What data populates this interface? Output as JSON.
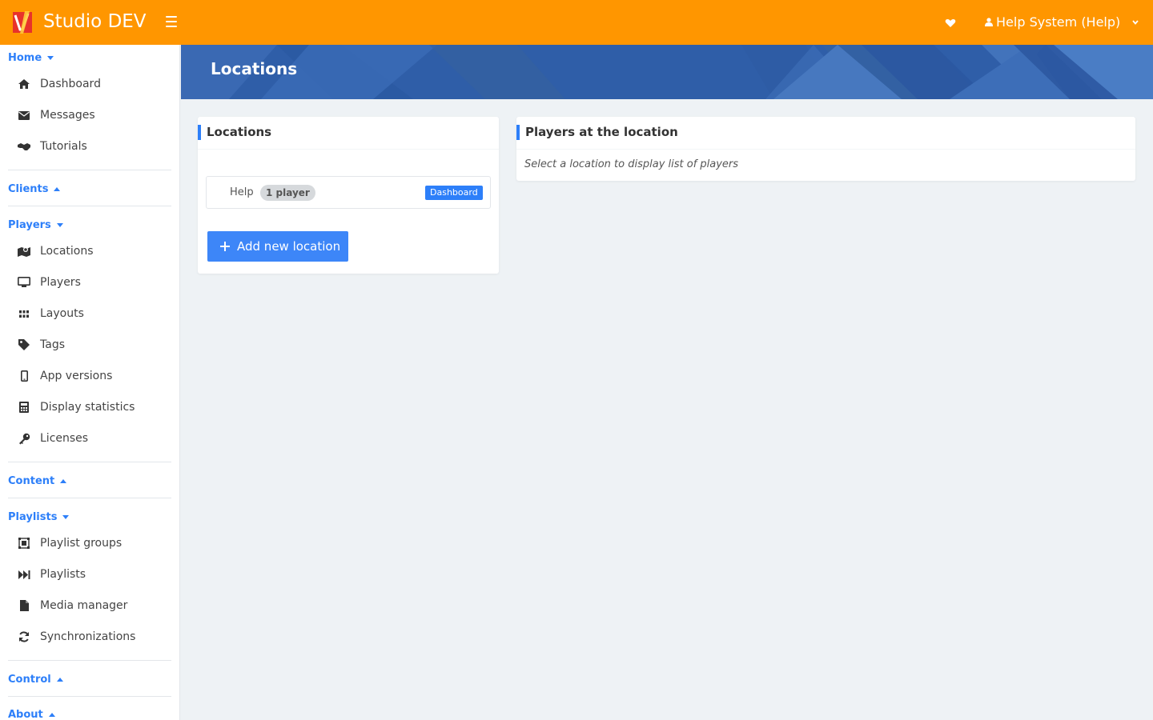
{
  "app": {
    "brand": "Studio DEV",
    "user_label": "Help System (Help)",
    "accent_color": "#ff9600",
    "link_color": "#2d7ff9"
  },
  "sidebar": {
    "sections": {
      "home": "Home",
      "clients": "Clients",
      "players": "Players",
      "content": "Content",
      "playlists": "Playlists",
      "control": "Control",
      "about": "About"
    },
    "items": {
      "dashboard": "Dashboard",
      "messages": "Messages",
      "tutorials": "Tutorials",
      "locations": "Locations",
      "players": "Players",
      "layouts": "Layouts",
      "tags": "Tags",
      "app_versions": "App versions",
      "display_statistics": "Display statistics",
      "licenses": "Licenses",
      "playlist_groups": "Playlist groups",
      "playlists": "Playlists",
      "media_manager": "Media manager",
      "synchronizations": "Synchronizations"
    }
  },
  "page": {
    "title": "Locations"
  },
  "locations_card": {
    "title": "Locations",
    "rows": [
      {
        "name": "Help",
        "badge": "1 player",
        "tag": "Dashboard"
      }
    ],
    "add_button": "Add new location"
  },
  "players_card": {
    "title": "Players at the location",
    "hint": "Select a location to display list of players"
  }
}
